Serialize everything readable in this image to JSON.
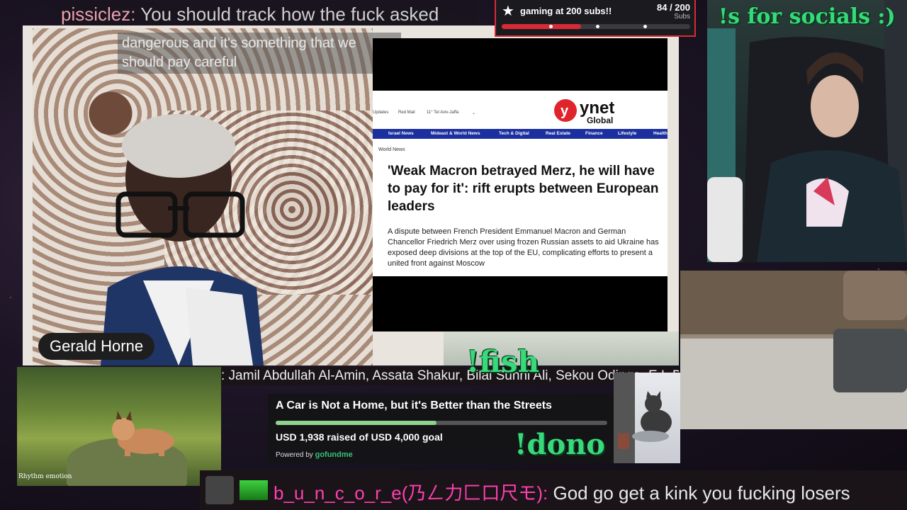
{
  "top_chat": {
    "user": "pissiclez:",
    "message": "You should track how the fuck asked"
  },
  "video": {
    "subtitle": "dangerous and it's something that we should pay careful",
    "speaker_name": "Gerald Horne",
    "article": {
      "topbar": [
        "Updates",
        "Red Mail",
        "11° Tel Aviv-Jaffa"
      ],
      "logo_main": "ynet",
      "logo_sub": "Global",
      "nav": [
        "Israel News",
        "Mideast & World News",
        "Tech & Digital",
        "Real Estate",
        "Finance",
        "Lifestyle",
        "Health"
      ],
      "section": "World News",
      "headline": "'Weak Macron betrayed Merz, he will have to pay for it': rift erupts between European leaders",
      "dek": "A dispute between French President Emmanuel Macron and German Chancellor Friedrich Merz over using frozen Russian assets to aid Ukraine has exposed deep divisions at the top of the EU, complicating efforts to present a united front against Moscow"
    }
  },
  "ticker": {
    "text": ": Jamil Abdullah Al-Amin, Assata Shakur, Bilal Sunni Ali, Sekou Odinga, E.L.D."
  },
  "overlays": {
    "fish": "!fish",
    "dono": "!dono",
    "socials": "!s for socials :)"
  },
  "lynx_panel": {
    "watermark": "Rhythm emotion"
  },
  "gofundme": {
    "title": "A Car is Not a Home, but it's Better than the Streets",
    "raised_text": "USD 1,938 raised of USD 4,000 goal",
    "raised": 1938,
    "goal": 4000,
    "powered_by": "Powered by",
    "brand": "gofundme"
  },
  "sub_goal": {
    "title": "gaming at 200 subs!!",
    "count_text": "84 / 200",
    "unit": "Subs",
    "current": 84,
    "target": 200,
    "milestones": [
      0.25,
      0.5,
      0.75
    ]
  },
  "bottom_chat": {
    "user": "b_u_n_c_o_r_e(乃ㄥ力匚口尺モ):",
    "message": "God go get a kink you fucking losers"
  },
  "colors": {
    "accent_green": "#38d97a",
    "goal_red": "#d82a36",
    "chat_pink": "#ff3fb0",
    "ynet_blue": "#1b2f9f",
    "ynet_red": "#e0242c"
  }
}
